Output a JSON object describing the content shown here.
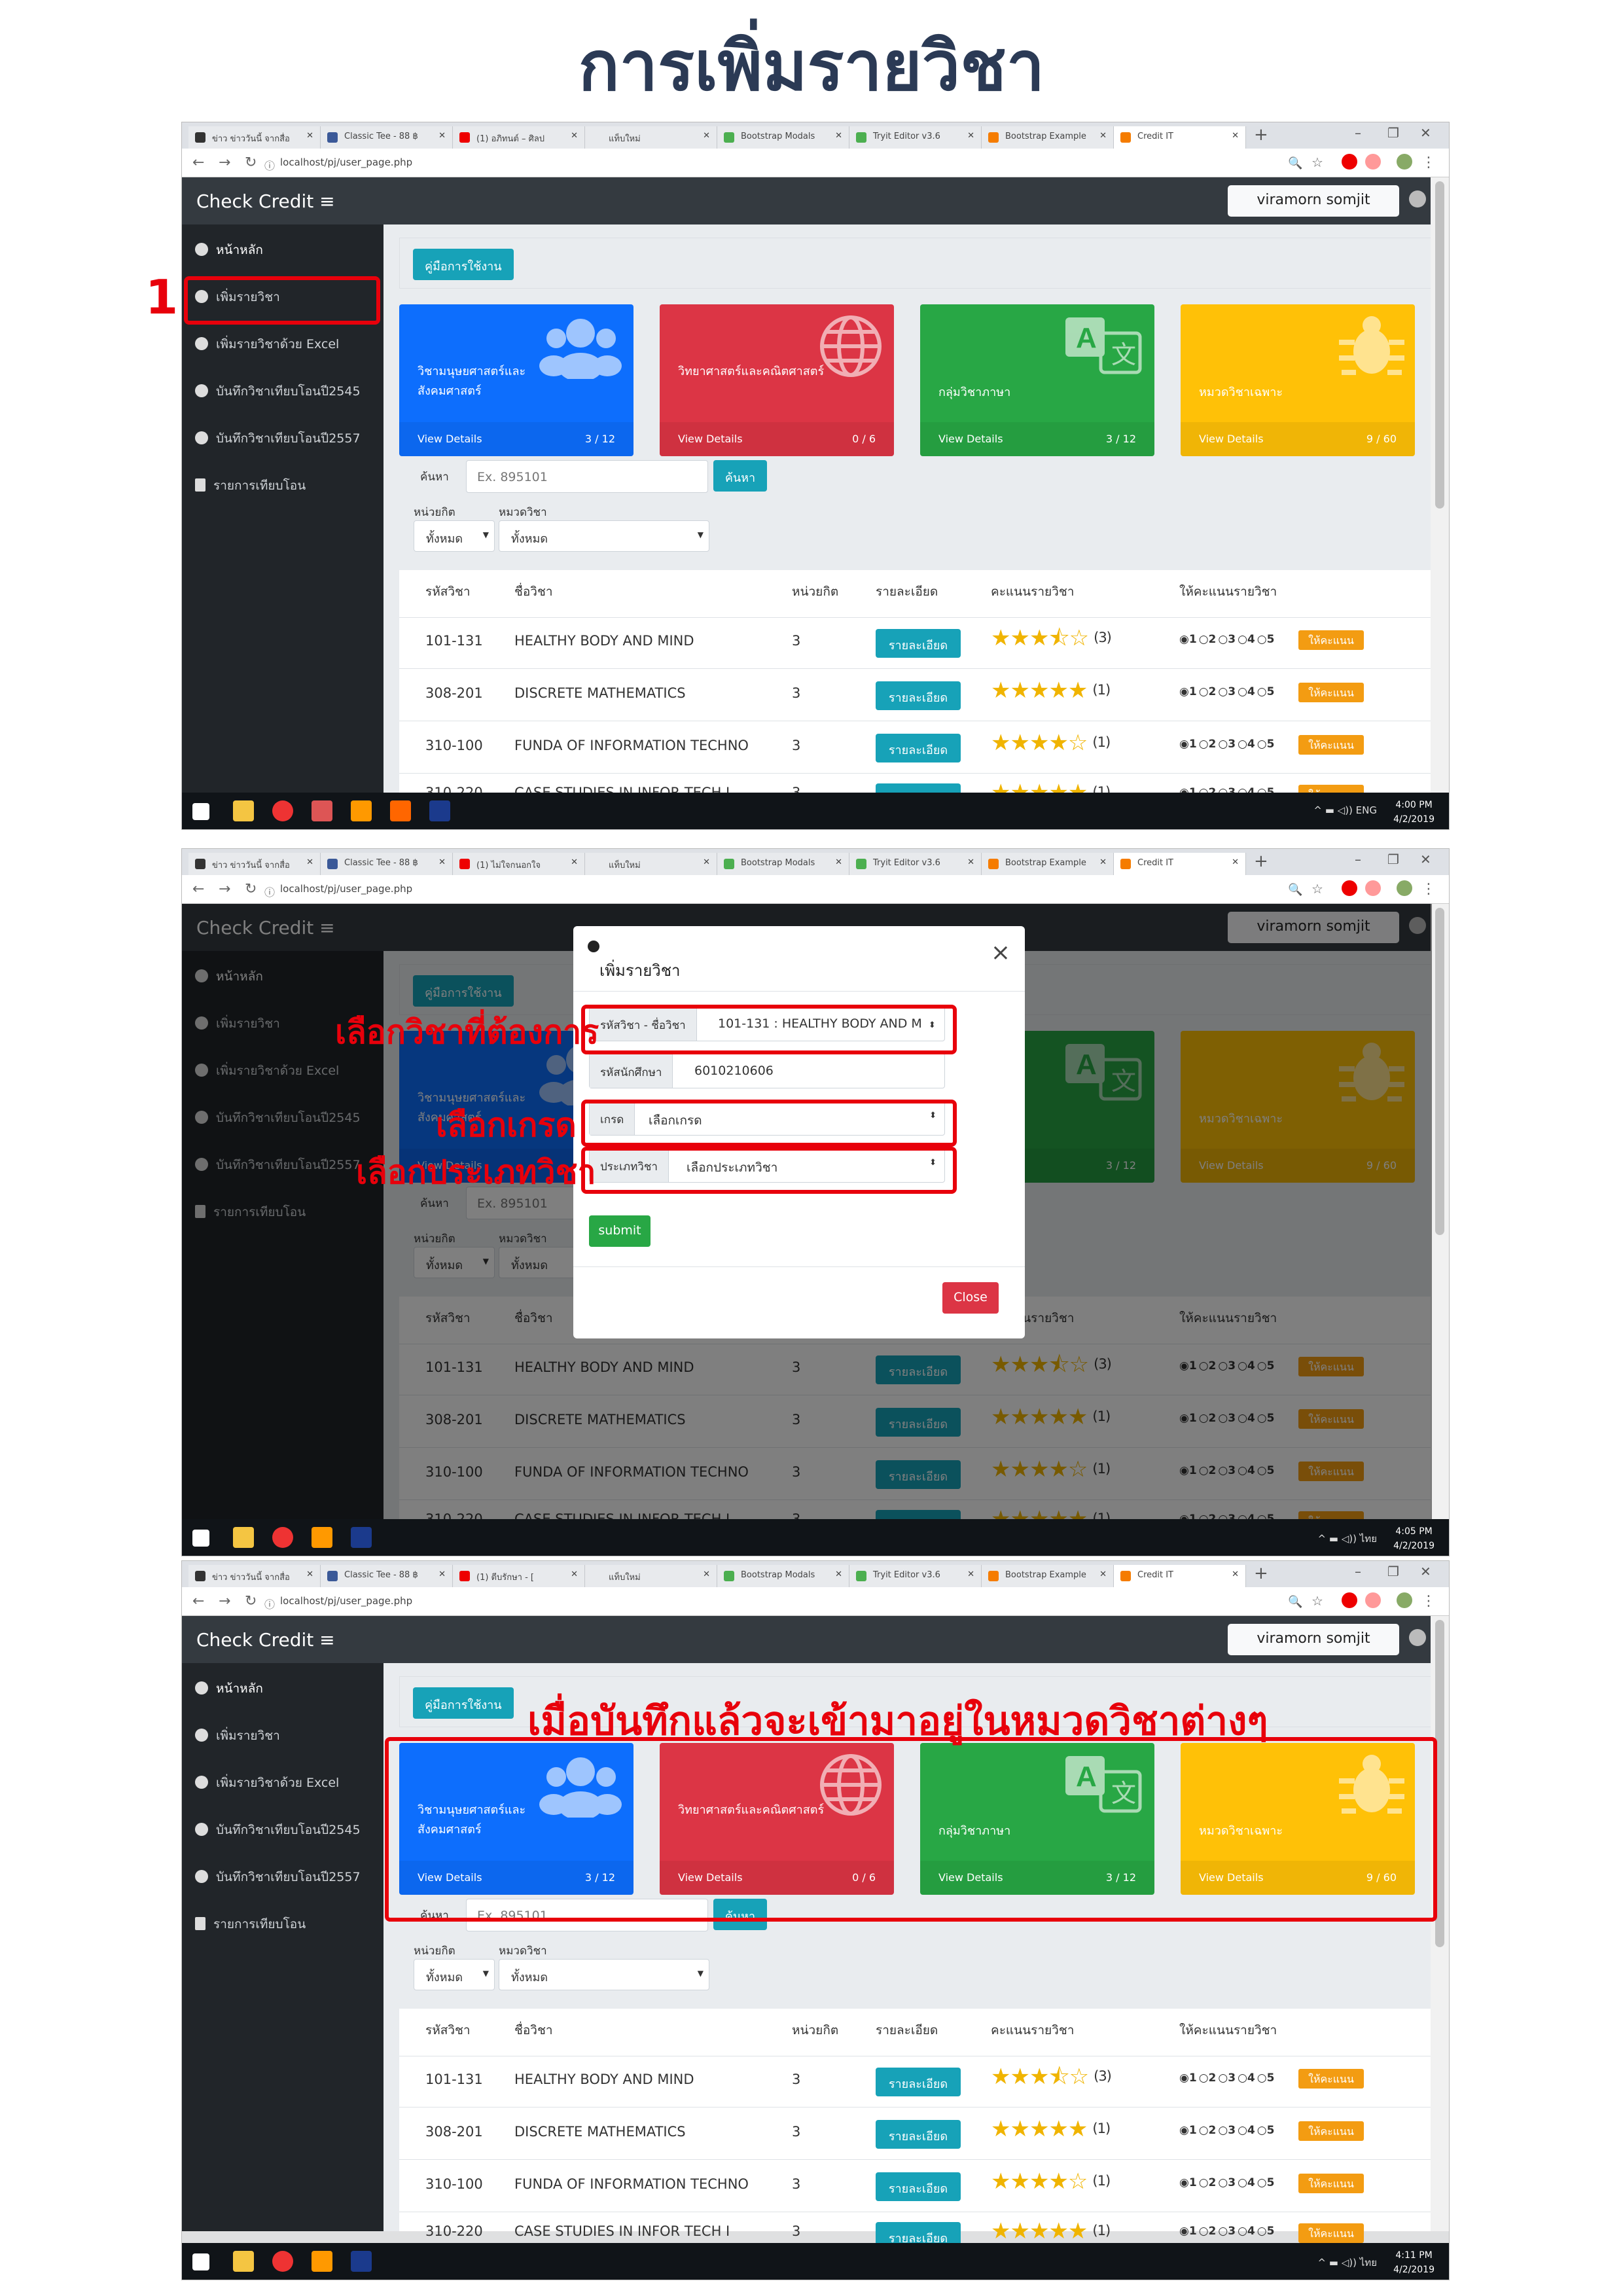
{
  "doc_title": "การเพิ่มรายวิชา",
  "tabs": [
    {
      "label": "ข่าว ข่าววันนี้ จากสื่อ"
    },
    {
      "label": "Classic Tee - 88 ฿"
    },
    {
      "label": "(1) อภิทนต์ – ศิลป"
    },
    {
      "label": "แท็บใหม่"
    },
    {
      "label": "Bootstrap Modals"
    },
    {
      "label": "Tryit Editor v3.6"
    },
    {
      "label": "Bootstrap Example"
    },
    {
      "label": "Credit IT"
    }
  ],
  "shot2_tab3": "(1) ไม่ใจกนอกใจ",
  "shot3_tab3": "(1) ตีบรักษา - [",
  "url": "localhost/pj/user_page.php",
  "brand": "Check Credit",
  "user": "viramorn somjit",
  "menu": [
    "หน้าหลัก",
    "เพิ่มรายวิชา",
    "เพิ่มรายวิชาด้วย Excel",
    "บันทึกวิชาเทียบโอนปี2545",
    "บันทึกวิชาเทียบโอนปี2557",
    "รายการเทียบโอน"
  ],
  "manual": "คู่มือการใช้งาน",
  "view_details": "View Details",
  "cards": [
    {
      "name": "วิชามนุษยศาสตร์และสังคมศาสตร์",
      "count": "3 / 12",
      "color": "#0d6efd",
      "icon": "users-icon"
    },
    {
      "name": "วิทยาศาสตร์และคณิตศาสตร์",
      "count": "0 / 6",
      "color": "#dc3545",
      "icon": "globe-icon"
    },
    {
      "name": "กลุ่มวิชาภาษา",
      "count": "3 / 12",
      "color": "#28a745",
      "icon": "language-icon"
    },
    {
      "name": "หมวดวิชาเฉพาะ",
      "count": "9 / 60",
      "color": "#ffc107",
      "icon": "bug-icon"
    }
  ],
  "search": {
    "label": "ค้นหา",
    "placeholder": "Ex. 895101",
    "button": "ค้นหา"
  },
  "filters": {
    "credit_label": "หน่วยกิต",
    "credit_value": "ทั้งหมด",
    "cat_label": "หมวดวิชา",
    "cat_value": "ทั้งหมด"
  },
  "table_headers": [
    "รหัสวิชา",
    "ชื่อวิชา",
    "หน่วยกิต",
    "รายละเอียด",
    "คะแนนรายวิชา",
    "ให้คะแนนรายวิชา"
  ],
  "detail_btn": "รายละเอียด",
  "rate_btn": "ให้คะแนน",
  "radio_opts": [
    "1",
    "2",
    "3",
    "4",
    "5"
  ],
  "rows": [
    {
      "code": "101-131",
      "name": "HEALTHY BODY AND MIND",
      "credit": "3",
      "stars": "★★★⯪☆",
      "reviews": "(3)"
    },
    {
      "code": "308-201",
      "name": "DISCRETE MATHEMATICS",
      "credit": "3",
      "stars": "★★★★★",
      "reviews": "(1)"
    },
    {
      "code": "310-100",
      "name": "FUNDA OF INFORMATION TECHNO",
      "credit": "3",
      "stars": "★★★★☆",
      "reviews": "(1)"
    },
    {
      "code": "310-220",
      "name": "CASE STUDIES IN INFOR TECH I",
      "credit": "3",
      "stars": "★★★★★",
      "reviews": "(1)"
    }
  ],
  "clocks": [
    {
      "time": "4:00 PM",
      "date": "4/2/2019",
      "lang": "ENG"
    },
    {
      "time": "4:05 PM",
      "date": "4/2/2019",
      "lang": "ไทย"
    },
    {
      "time": "4:11 PM",
      "date": "4/2/2019",
      "lang": "ไทย"
    }
  ],
  "modal": {
    "title": "เพิ่มรายวิชา",
    "course_label": "รหัสวิชา - ชื่อวิชา",
    "course_value": "101-131 : HEALTHY BODY AND M",
    "student_label": "รหัสนักศึกษา",
    "student_value": "6010210606",
    "grade_label": "เกรด",
    "grade_value": "เลือกเกรด",
    "type_label": "ประเภทวิชา",
    "type_value": "เลือกประเภทวิชา",
    "submit": "submit",
    "close": "Close"
  },
  "annotations": {
    "step1": "1",
    "select_course": "เลือกวิชาที่ต้องการ",
    "select_grade": "เลือกเกรด",
    "select_type": "เลือกประเภทวิชา",
    "after_save": "เมื่อบันทึกแล้วจะเข้ามาอยู่ในหมวดวิชาต่างๆ"
  },
  "colors": {
    "accent": "#17a2b8",
    "annotation": "#e8000b",
    "dark": "#343a40"
  }
}
